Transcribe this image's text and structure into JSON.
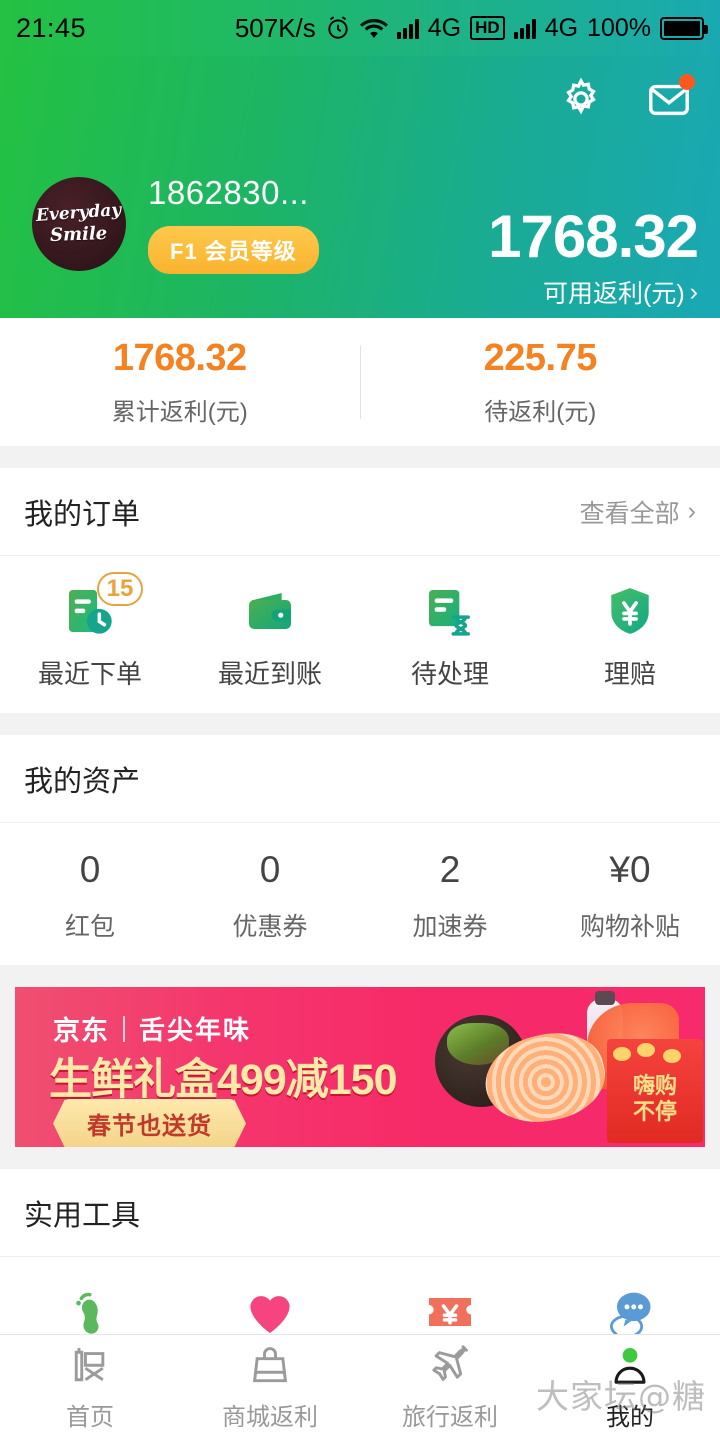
{
  "statusbar": {
    "time": "21:45",
    "network_speed": "507K/s",
    "alarm_icon": "alarm-clock-icon",
    "wifi_icon": "wifi-icon",
    "signal1_label": "4G",
    "hd_label": "HD",
    "signal2_label": "4G",
    "battery_percent": "100%"
  },
  "header": {
    "settings_icon": "gear-icon",
    "mail_icon": "mail-icon",
    "avatar_line1": "Everyday",
    "avatar_line2": "Smile",
    "username": "1862830...",
    "level_badge": "F1 会员等级",
    "balance_value": "1768.32",
    "balance_label": "可用返利(元)",
    "balance_chevron": "›",
    "gradient_from": "#24c143",
    "gradient_to": "#1aa8b5"
  },
  "stats": {
    "accent_color": "#f58220",
    "items": [
      {
        "value": "1768.32",
        "label": "累计返利(元)"
      },
      {
        "value": "225.75",
        "label": "待返利(元)"
      }
    ]
  },
  "orders": {
    "title": "我的订单",
    "more_label": "查看全部",
    "more_chevron": "›",
    "items": [
      {
        "label": "最近下单",
        "icon": "order-clock-icon",
        "badge": "15"
      },
      {
        "label": "最近到账",
        "icon": "wallet-icon",
        "badge": ""
      },
      {
        "label": "待处理",
        "icon": "order-hourglass-icon",
        "badge": ""
      },
      {
        "label": "理赔",
        "icon": "shield-yuan-icon",
        "badge": ""
      }
    ]
  },
  "assets": {
    "title": "我的资产",
    "items": [
      {
        "value": "0",
        "label": "红包"
      },
      {
        "value": "0",
        "label": "优惠券"
      },
      {
        "value": "2",
        "label": "加速券"
      },
      {
        "value": "¥0",
        "label": "购物补贴"
      }
    ]
  },
  "banner": {
    "brand": "京东",
    "subtitle": "舌尖年味",
    "headline": "生鲜礼盒499减150",
    "button_label": "春节也送货",
    "envelope_line1": "嗨购",
    "envelope_line2": "不停",
    "background_color": "#f62a68"
  },
  "tools": {
    "title": "实用工具",
    "items": [
      {
        "icon": "footprint-icon",
        "color": "#5cb85c"
      },
      {
        "icon": "heart-icon",
        "color": "#f5447f"
      },
      {
        "icon": "coupon-yuan-icon",
        "color": "#f0705c"
      },
      {
        "icon": "chat-bubble-icon",
        "color": "#5b9bd5"
      }
    ]
  },
  "bottomnav": {
    "items": [
      {
        "label": "首页",
        "icon": "home-rebate-icon",
        "active": false
      },
      {
        "label": "商城返利",
        "icon": "shopping-bag-icon",
        "active": false
      },
      {
        "label": "旅行返利",
        "icon": "airplane-icon",
        "active": false
      },
      {
        "label": "我的",
        "icon": "person-icon",
        "active": true
      }
    ]
  },
  "watermark": {
    "text": "大家坛@糖"
  }
}
